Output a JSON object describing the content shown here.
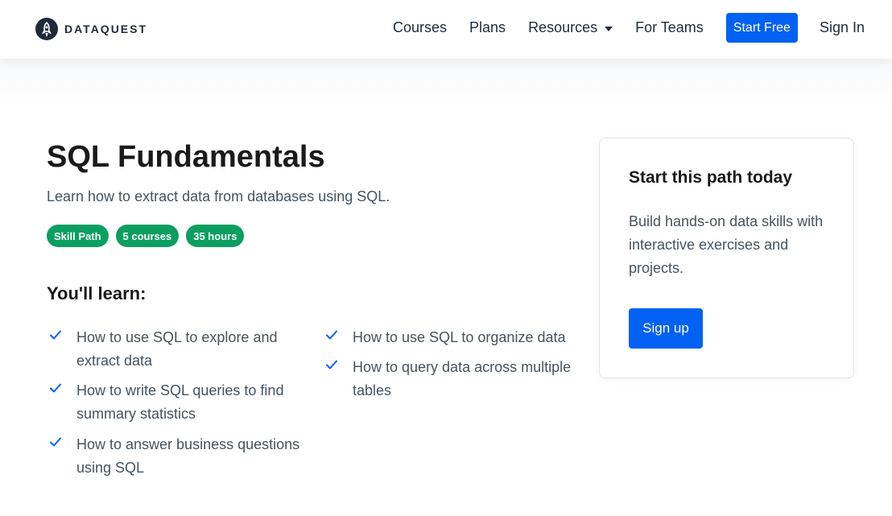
{
  "brand": {
    "name": "DATAQUEST",
    "logo_icon": "rocket-logo-icon"
  },
  "nav": {
    "courses": "Courses",
    "plans": "Plans",
    "resources": "Resources",
    "for_teams": "For Teams",
    "start_free": "Start Free",
    "sign_in": "Sign In"
  },
  "path": {
    "title": "SQL Fundamentals",
    "subtitle": "Learn how to extract data from databases using SQL.",
    "badges": [
      "Skill Path",
      "5 courses",
      "35 hours"
    ]
  },
  "learn": {
    "heading": "You'll learn:",
    "items": [
      "How to use SQL to explore and extract data",
      "How to write SQL queries to find summary statistics",
      "How to answer business questions using SQL",
      "How to use SQL to organize data",
      "How to query data across multiple tables"
    ]
  },
  "card": {
    "title": "Start this path today",
    "text": "Build hands-on data skills with interactive exercises and projects.",
    "button": "Sign up"
  },
  "colors": {
    "primary": "#0061f2",
    "badge": "#0b9f5f",
    "text_muted": "#46535f",
    "brand_dark": "#1e2a3a"
  }
}
